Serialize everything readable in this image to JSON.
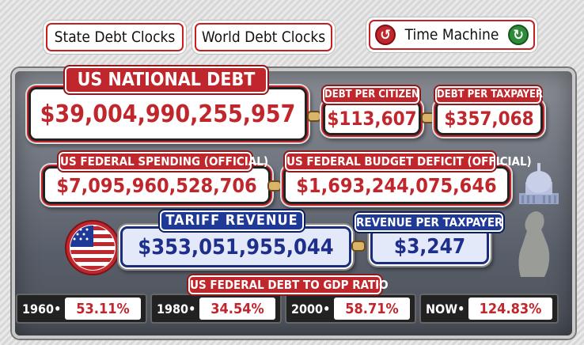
{
  "tabs": {
    "state": "State Debt Clocks",
    "world": "World Debt Clocks",
    "time_machine": "Time Machine"
  },
  "national_debt": {
    "label": "US NATIONAL DEBT",
    "value": "$39,004,990,255,957"
  },
  "per_citizen": {
    "label": "DEBT PER CITIZEN",
    "value": "$113,607"
  },
  "per_taxpayer": {
    "label": "DEBT PER TAXPAYER",
    "value": "$357,068"
  },
  "spending": {
    "label": "US FEDERAL SPENDING (OFFICIAL)",
    "value": "$7,095,960,528,706"
  },
  "deficit": {
    "label": "US FEDERAL BUDGET DEFICIT (OFFICIAL)",
    "value": "$1,693,244,075,646"
  },
  "tariff": {
    "label": "TARIFF REVENUE",
    "value": "$353,051,955,044"
  },
  "revenue_per_taxpayer": {
    "label": "REVENUE PER TAXPAYER",
    "value": "$3,247"
  },
  "gdp_ratio": {
    "label": "US FEDERAL DEBT TO GDP RATIO",
    "items": [
      {
        "year": "1960",
        "value": "53.11%"
      },
      {
        "year": "1980",
        "value": "34.54%"
      },
      {
        "year": "2000",
        "value": "58.71%"
      },
      {
        "year": "NOW",
        "value": "124.83%"
      }
    ]
  },
  "colors": {
    "accent_red": "#c0272d",
    "accent_blue": "#1e3a96",
    "green": "#2e8b3a"
  },
  "icons": [
    "rewind-icon",
    "refresh-icon",
    "us-flag-icon",
    "capitol-icon"
  ]
}
